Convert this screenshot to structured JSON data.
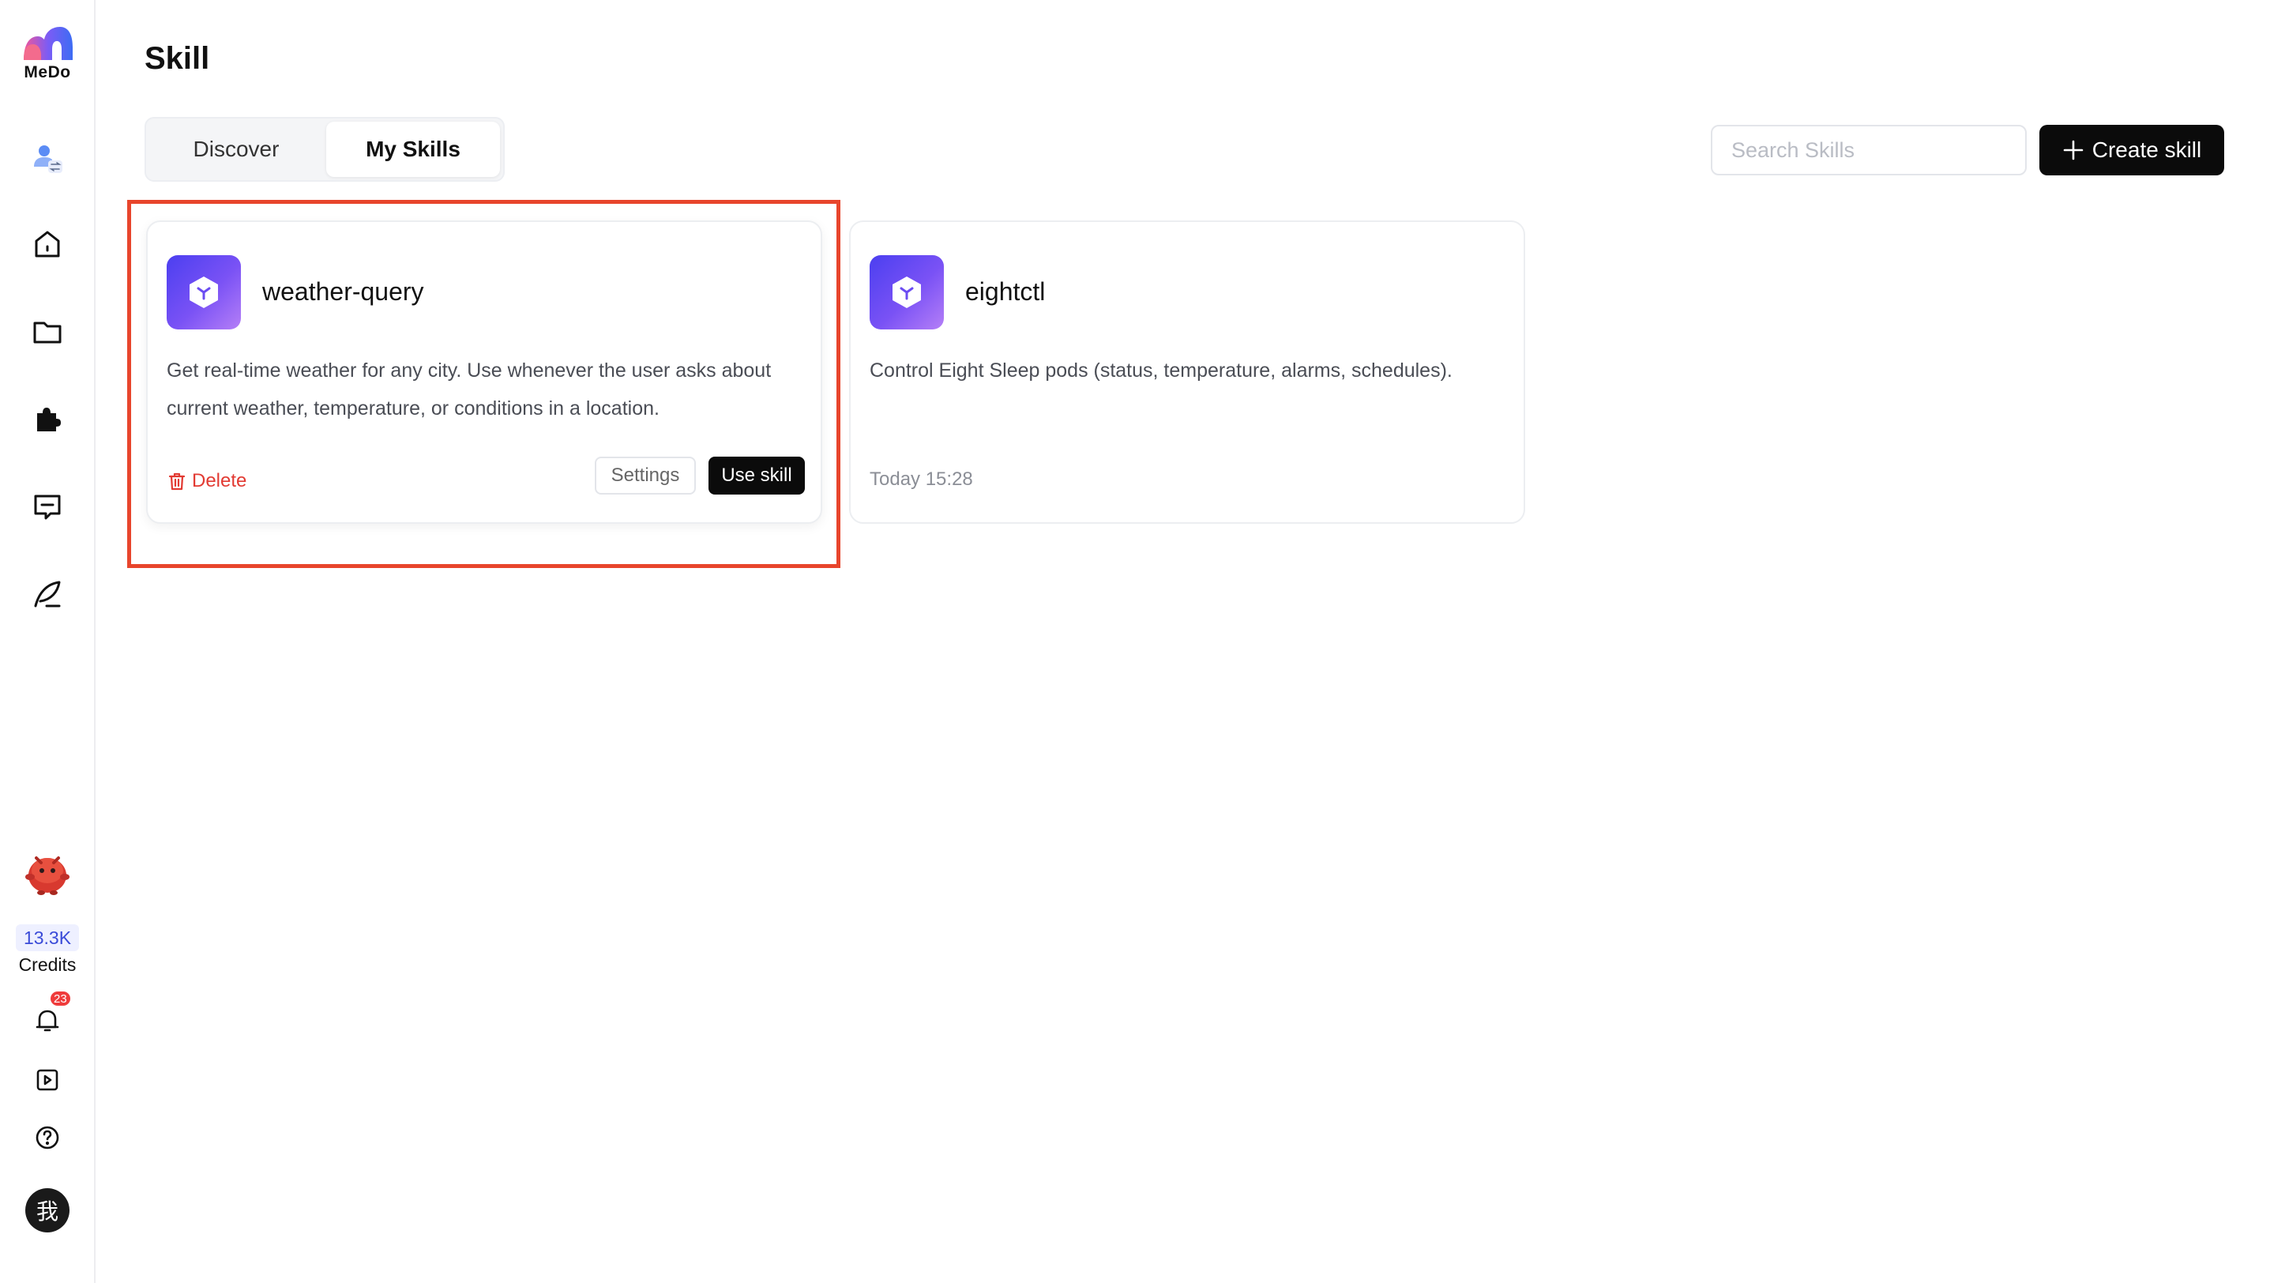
{
  "brand": {
    "name": "MeDo"
  },
  "sidebar": {
    "icons": [
      "profile-switch-icon",
      "home-icon",
      "folder-icon",
      "puzzle-icon",
      "message-icon",
      "quill-icon"
    ],
    "credits_value": "13.3K",
    "credits_label": "Credits",
    "notification_count": "23",
    "avatar_label": "我"
  },
  "page": {
    "title": "Skill"
  },
  "tabs": [
    {
      "label": "Discover",
      "active": false
    },
    {
      "label": "My Skills",
      "active": true
    }
  ],
  "search": {
    "placeholder": "Search Skills",
    "value": ""
  },
  "create_button": {
    "label": "Create skill"
  },
  "skills": [
    {
      "name": "weather-query",
      "description": "Get real-time weather for any city. Use whenever the user asks about current weather, temperature, or conditions in a location.",
      "delete_label": "Delete",
      "settings_label": "Settings",
      "use_label": "Use skill"
    },
    {
      "name": "eightctl",
      "description": "Control Eight Sleep pods (status, temperature, alarms, schedules).",
      "timestamp": "Today 15:28"
    }
  ],
  "colors": {
    "accent_dark": "#0b0b0b",
    "danger": "#e23a32",
    "highlight_border": "#e8452c",
    "icon_gradient_start": "#4b3ff0",
    "icon_gradient_end": "#b57ff7"
  }
}
